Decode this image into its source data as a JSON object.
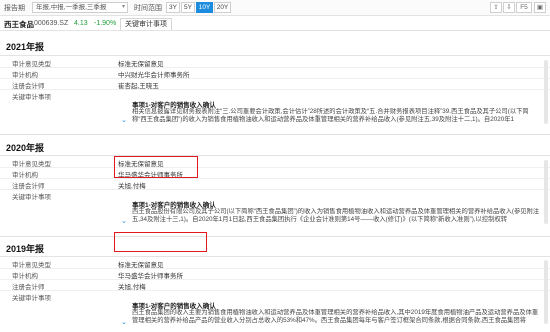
{
  "toolbar": {
    "report_label": "报告期",
    "report_select": "年报,中报,一季报,三季报",
    "period_label": "时间范围",
    "ranges": [
      "3Y",
      "5Y",
      "10Y",
      "20Y"
    ],
    "active_range": "10Y",
    "icons": [
      "⇧",
      "⇩",
      "F5",
      "▣"
    ]
  },
  "stock": {
    "name": "西王食品",
    "code": "000639.SZ",
    "price": "4.13",
    "change": "-1.90%",
    "tab": "关键审计事项"
  },
  "sections": [
    {
      "year": "2021年报",
      "rows": [
        {
          "key": "审计意见类型",
          "value": "标准无保留意见"
        },
        {
          "key": "审计机构",
          "value": "中兴财光华会计师事务所"
        },
        {
          "key": "注册会计师",
          "value": "崔杏起,王晓玉"
        },
        {
          "key": "关键审计事项",
          "value": ""
        }
      ],
      "matter_title": "事项1-对客户的销售收入确认",
      "matter_text": "相关信息披露详见财务报表附注“三.公司重要会计政策,会计估计”28所述的会计政策及“五.合并财务报表项目注释”39.西王食品及其子公司(以下简称“西王食品集团”)的收入为销售食用植物油收入和运动营养品及体重管理相关的营养补给品收入(参见附注五,39及附注十二,1)。自2020年1"
    },
    {
      "year": "2020年报",
      "rows": [
        {
          "key": "审计意见类型",
          "value": "标准无保留意见"
        },
        {
          "key": "审计机构",
          "value": "华马盛华会计师事务所"
        },
        {
          "key": "注册会计师",
          "value": "关旭,付梅"
        },
        {
          "key": "关键审计事项",
          "value": ""
        }
      ],
      "matter_title": "事项1-对客户的销售收入确认",
      "matter_text": "西王食品股份有限公司及其子公司(以下简称“西王食品集团”)的收入为销售食用植物油收入和运动营养品及体重管理相关的营养补给品收入(参见附注五,34及附注十三,1)。自2020年1月1日起,西王食品集团执行《企业会计准则第14号——收入(修订)》(以下简称“新收入准则”),以控制权转"
    },
    {
      "year": "2019年报",
      "rows": [
        {
          "key": "审计意见类型",
          "value": "标准无保留意见"
        },
        {
          "key": "审计机构",
          "value": "华马盛华会计师事务所"
        },
        {
          "key": "注册会计师",
          "value": "关旭,付梅"
        },
        {
          "key": "关键审计事项",
          "value": ""
        }
      ],
      "matter_title": "事项1-对客户的销售收入确认",
      "matter_text": "西王食品集团的收入主要为销售食用植物油收入和运动营养品及体重管理相关的营养补给品收入,其中2019年度食用植物油产品及运动营养品及体重管理相关的营养补给品产品的营业收入分别占总收入的53%和47%。西王食品集团每年与客户签订框架合同条款,根据合同条款,西王食品集团将"
    }
  ],
  "colors": {
    "accent": "#1e8cde",
    "down": "#1f9e3a",
    "highlight_box": "#e0191e"
  }
}
